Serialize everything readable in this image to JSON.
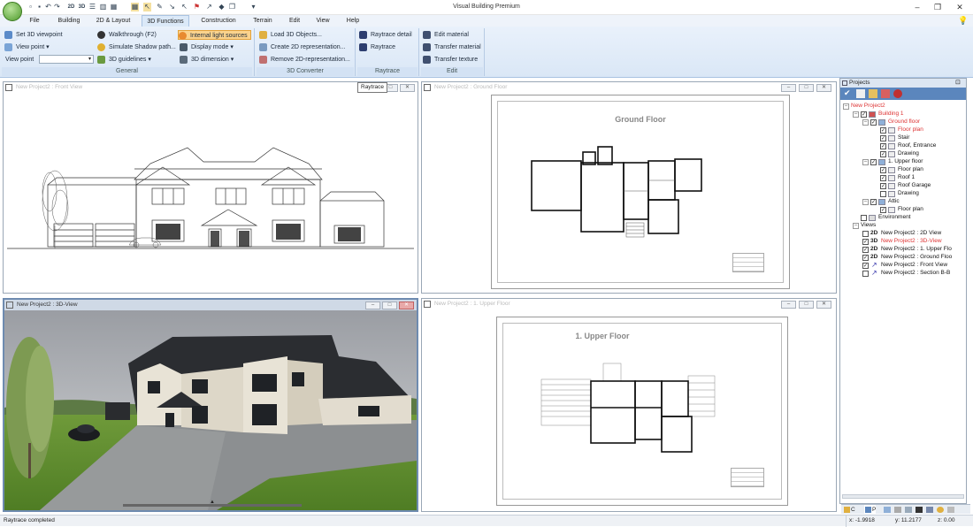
{
  "app": {
    "title": "Visual Building Premium"
  },
  "colors": {
    "accent": "#dbe9f8",
    "highlight": "#fbd38d",
    "active_tree_item": "#dd3333"
  },
  "menu_tabs": [
    {
      "label": "File"
    },
    {
      "label": "Building"
    },
    {
      "label": "2D & Layout"
    },
    {
      "label": "3D Functions",
      "active": true
    },
    {
      "label": "Construction"
    },
    {
      "label": "Terrain"
    },
    {
      "label": "Edit"
    },
    {
      "label": "View"
    },
    {
      "label": "Help"
    }
  ],
  "ribbon": {
    "general": {
      "label": "General",
      "set_viewpoint": "Set 3D viewpoint",
      "view_point": "View point",
      "view_point_field_label": "View point",
      "view_point_value": "",
      "walkthrough": "Walkthrough (F2)",
      "simulate_shadow": "Simulate Shadow path...",
      "guidelines": "3D guidelines",
      "internal_light": "Internal light sources",
      "display_mode": "Display mode",
      "dimension": "3D dimension"
    },
    "converter": {
      "label": "3D Converter",
      "load_objects": "Load 3D Objects...",
      "create_2d": "Create 2D representation...",
      "remove_2d": "Remove 2D-representation..."
    },
    "raytrace": {
      "label": "Raytrace",
      "detail": "Raytrace detail",
      "raytrace": "Raytrace"
    },
    "edit": {
      "label": "Edit",
      "edit_material": "Edit material",
      "transfer_material": "Transfer material",
      "transfer_texture": "Transfer texture"
    }
  },
  "tooltip": {
    "text": "Raytrace"
  },
  "viewports": {
    "front": {
      "title": "New Project2 : Front View"
    },
    "ground": {
      "title": "New Project2 : Ground Floor",
      "drawing_title": "Ground Floor"
    },
    "view3d": {
      "title": "New Project2 : 3D-View"
    },
    "upper": {
      "title": "New Project2 : 1. Upper Floor",
      "drawing_title": "1. Upper Floor"
    }
  },
  "projects_panel": {
    "title": "Projects",
    "tree": [
      {
        "label": "New Project2",
        "color": "red"
      },
      {
        "label": "Building 1",
        "color": "red"
      },
      {
        "label": "Ground floor",
        "color": "red"
      },
      {
        "label": "Floor plan",
        "color": "red"
      },
      {
        "label": "Stair"
      },
      {
        "label": "Roof, Entrance"
      },
      {
        "label": "Drawing"
      },
      {
        "label": "1. Upper floor"
      },
      {
        "label": "Floor plan"
      },
      {
        "label": "Roof 1"
      },
      {
        "label": "Roof Garage"
      },
      {
        "label": "Drawing"
      },
      {
        "label": "Attic"
      },
      {
        "label": "Floor plan"
      },
      {
        "label": "Environment"
      },
      {
        "label": "Views"
      },
      {
        "label": "New Project2 : 2D View",
        "tag": "2D"
      },
      {
        "label": "New Project2 : 3D-View",
        "tag": "3D",
        "color": "red"
      },
      {
        "label": "New Project2 : 1. Upper Flo",
        "tag": "2D"
      },
      {
        "label": "New Project2 : Ground Floo",
        "tag": "2D"
      },
      {
        "label": "New Project2 : Front View"
      },
      {
        "label": "New Project2 : Section B-B"
      }
    ],
    "bottom_tabs": [
      "C",
      "P"
    ]
  },
  "status": {
    "message": "Raytrace completed",
    "x": "x: -1.9918",
    "y": "y: 11.2177",
    "z": "z: 0.00"
  }
}
